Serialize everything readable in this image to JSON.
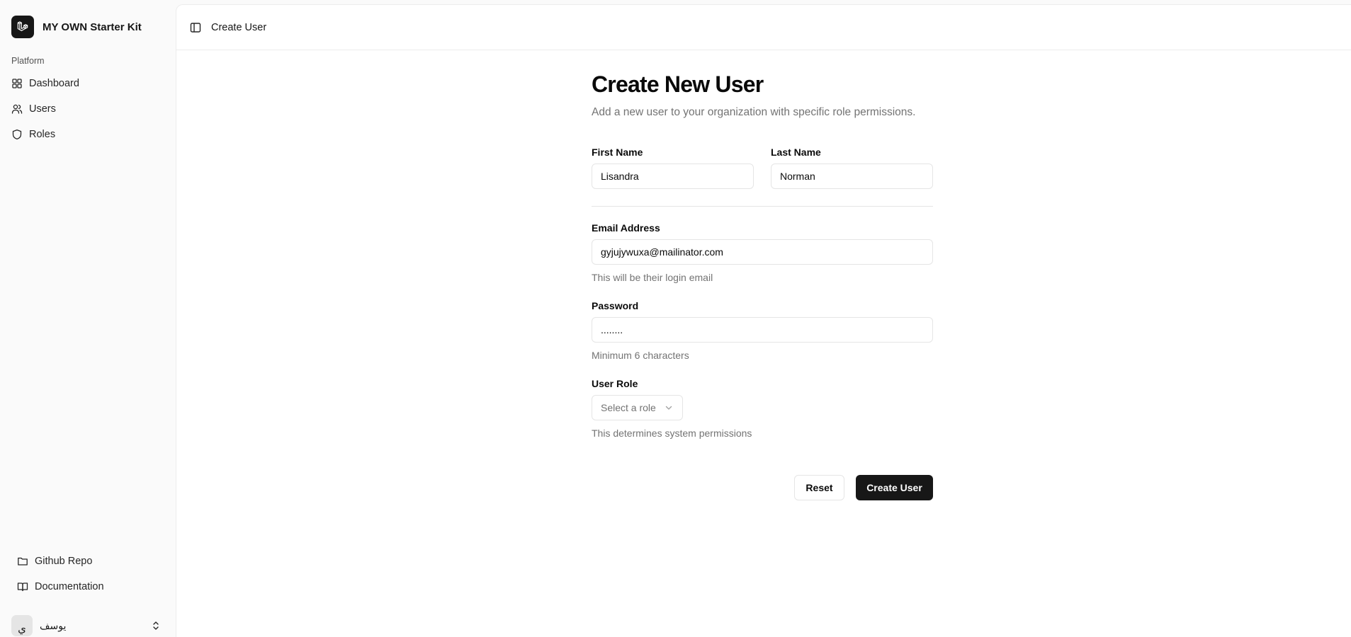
{
  "app": {
    "name": "MY OWN Starter Kit"
  },
  "sidebar": {
    "section_label": "Platform",
    "items": [
      {
        "label": "Dashboard",
        "icon": "grid-icon"
      },
      {
        "label": "Users",
        "icon": "users-icon"
      },
      {
        "label": "Roles",
        "icon": "shield-icon"
      }
    ],
    "footer_items": [
      {
        "label": "Github Repo",
        "icon": "folder-icon"
      },
      {
        "label": "Documentation",
        "icon": "book-icon"
      }
    ],
    "user": {
      "avatar_initial": "ي",
      "name": "يوسف"
    }
  },
  "header": {
    "breadcrumb": "Create User"
  },
  "form": {
    "title": "Create New User",
    "subtitle": "Add a new user to your organization with specific role permissions.",
    "first_name": {
      "label": "First Name",
      "value": "Lisandra"
    },
    "last_name": {
      "label": "Last Name",
      "value": "Norman"
    },
    "email": {
      "label": "Email Address",
      "value": "gyjujywuxa@mailinator.com",
      "hint": "This will be their login email"
    },
    "password": {
      "label": "Password",
      "value": "........",
      "hint": "Minimum 6 characters"
    },
    "role": {
      "label": "User Role",
      "placeholder": "Select a role",
      "hint": "This determines system permissions"
    },
    "reset_label": "Reset",
    "submit_label": "Create User"
  },
  "colors": {
    "primary": "#171717",
    "muted_text": "#737373",
    "border": "#e5e5e5"
  }
}
